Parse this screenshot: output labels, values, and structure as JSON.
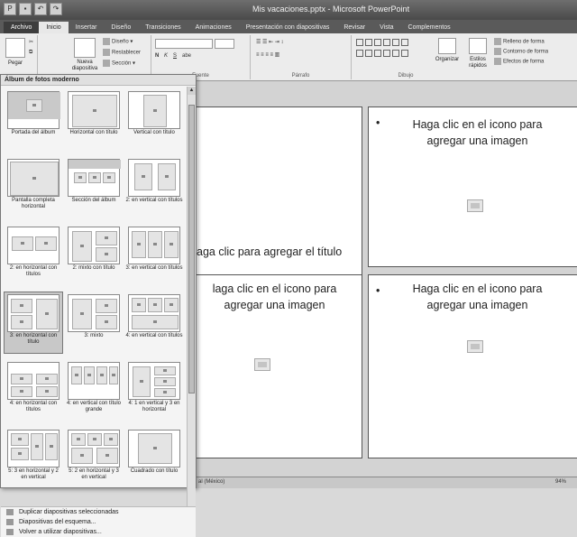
{
  "window": {
    "title": "Mis vacaciones.pptx - Microsoft PowerPoint"
  },
  "tabs": [
    "Archivo",
    "Inicio",
    "Insertar",
    "Diseño",
    "Transiciones",
    "Animaciones",
    "Presentación con diapositivas",
    "Revisar",
    "Vista",
    "Complementos"
  ],
  "ribbon": {
    "paste_label": "Pegar",
    "new_slide_label": "Nueva diapositiva",
    "layout_label": "Diseño",
    "reset_label": "Restablecer",
    "section_label": "Sección",
    "font_group": "Fuente",
    "paragraph_group": "Párrafo",
    "drawing_group": "Dibujo",
    "arrange_label": "Organizar",
    "styles_label": "Estilos rápidos",
    "fill_label": "Relleno de forma",
    "outline_label": "Contorno de forma",
    "effects_label": "Efectos de forma"
  },
  "panel": {
    "heading": "Álbum de fotos moderno",
    "layouts": [
      "Portada del álbum",
      "Horizontal con título",
      "Vertical con título",
      "Pantalla completa horizontal",
      "Sección del álbum",
      "2: en vertical con títulos",
      "2: en horizontal con títulos",
      "2: mixto con título",
      "3: en vertical con títulos",
      "3: en horizontal con título",
      "3: mixto",
      "4: en vertical con títulos",
      "4: en horizontal con títulos",
      "4: en vertical con título grande",
      "4: 1 en vertical y 3 en horizontal",
      "5: 3 en horizontal y 2 en vertical",
      "5: 2 en horizontal y 3 en vertical",
      "Cuadrado con título"
    ],
    "menu": [
      "Duplicar diapositivas seleccionadas",
      "Diapositivas del esquema...",
      "Volver a utilizar diapositivas..."
    ]
  },
  "slide": {
    "title_placeholder": "Haga clic para agregar el título",
    "image_placeholder": "Haga clic en el icono para agregar una imagen",
    "image_placeholder_line1": "Haga clic en el icono para",
    "image_placeholder_line2": "agregar una imagen",
    "image_placeholder_cut_line1": "laga clic en el icono para",
    "title_placeholder_cut": "aga clic para agregar el título"
  },
  "status": {
    "language": "al (México)",
    "zoom": "94%"
  }
}
